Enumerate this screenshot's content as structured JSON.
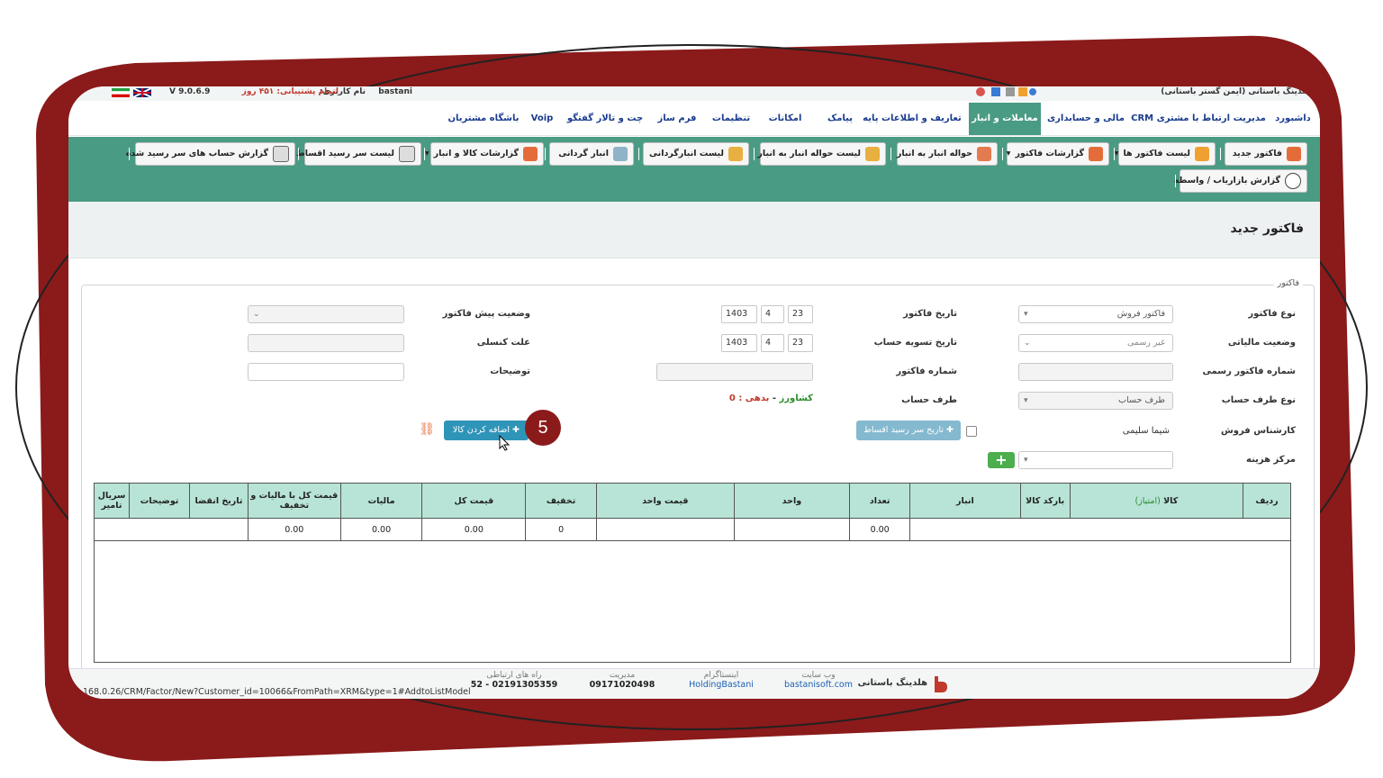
{
  "colors": {
    "frame": "#8b1a1a",
    "toolbar": "#4a9b84",
    "header_row": "#b7e4d6",
    "link_blue": "#1a3c8f"
  },
  "topbar": {
    "username_label": "نام کاربری:",
    "username": "bastani",
    "support_label": "اتمام پشتیبانی: ۴۵۱ روز",
    "version": "V 9.0.6.9",
    "company": "هلدینگ باستانی (ایمن گستر باستانی)",
    "flags": [
      "iran-flag-icon",
      "uk-flag-icon"
    ]
  },
  "menu": [
    {
      "label": "داشبورد"
    },
    {
      "label": "مدیریت ارتباط با مشتری CRM"
    },
    {
      "label": "مالی و حسابداری"
    },
    {
      "label": "معاملات و انبار",
      "active": true
    },
    {
      "label": "تعاریف و اطلاعات پایه"
    },
    {
      "label": "پیامک"
    },
    {
      "label": "امکانات"
    },
    {
      "label": "تنظیمات"
    },
    {
      "label": "فرم ساز"
    },
    {
      "label": "چت و تالار گفتگو"
    },
    {
      "label": "Voip"
    },
    {
      "label": "باشگاه مشتریان"
    }
  ],
  "toolbar": {
    "buttons": [
      {
        "label": "فاکتور جدید",
        "icon": "new-invoice-icon"
      },
      {
        "label": "لیست فاکتور ها",
        "icon": "invoice-list-icon",
        "dropdown": true
      },
      {
        "label": "گزارشات فاکتور",
        "icon": "invoice-report-icon",
        "dropdown": true
      },
      {
        "label": "حواله انبار به انبار",
        "icon": "warehouse-transfer-icon"
      },
      {
        "label": "لیست حواله انبار به انبار",
        "icon": "transfer-list-icon"
      },
      {
        "label": "لیست انبارگردانی",
        "icon": "stocktaking-list-icon"
      },
      {
        "label": "انبار گردانی",
        "icon": "stocktaking-icon"
      },
      {
        "label": "گزارشات کالا و انبار",
        "icon": "goods-report-icon",
        "dropdown": true
      },
      {
        "label": "لیست سر رسید اقساط",
        "icon": "installments-icon"
      },
      {
        "label": "گزارش حساب های سر رسید شده",
        "icon": "due-accounts-icon"
      },
      {
        "label": "گزارش بازاریاب / واسطه",
        "icon": "marketer-report-icon"
      }
    ]
  },
  "page_title": "فاکتور جدید",
  "form": {
    "legend": "فاکتور",
    "invoice_type_label": "نوع فاکتور",
    "invoice_type_value": "فاکتور فروش",
    "tax_status_label": "وضعیت مالیاتی",
    "tax_status_value": "غیر رسمی",
    "official_number_label": "شماره فاکتور رسمی",
    "account_side_type_label": "نوع طرف حساب",
    "account_side_type_value": "طرف حساب",
    "sales_expert_label": "کارشناس فروش",
    "sales_expert_value": "شیما سلیمی",
    "cost_center_label": "مرکز هزینه",
    "invoice_date_label": "تاریخ فاکتور",
    "settle_date_label": "تاریخ تسویه حساب",
    "invoice_number_label": "شماره فاکتور",
    "account_side_label": "طرف حساب",
    "date_day": "23",
    "date_month": "4",
    "date_year": "1403",
    "farmer_label": "کشاورز",
    "debt_label": "بدهی : 0",
    "installment_button": "تاریخ سر رسید اقساط",
    "pre_status_label": "وضعیت پیش فاکتور",
    "cancel_reason_label": "علت کنسلی",
    "description_label": "توضیحات",
    "add_goods_button": "اضافه کردن کالا",
    "step_badge": "5"
  },
  "table": {
    "headers": [
      "ردیف",
      "کالا",
      "بارکد کالا",
      "انبار",
      "تعداد",
      "واحد",
      "قیمت واحد",
      "تخفیف",
      "قیمت کل",
      "مالیات",
      "قیمت کل با مالیات و تخفیف",
      "تاریخ انقضا",
      "توضیحات",
      "سریال تامیر"
    ],
    "goods_points_label": "(امتیاز)",
    "totals": {
      "count": "0.00",
      "discount": "0",
      "total": "0.00",
      "tax": "0.00",
      "grand": "0.00"
    }
  },
  "footer": {
    "url": "168.0.26/CRM/Factor/New?Customer_id=10066&FromPath=XRM&type=1#AddtoListModel",
    "contact_label": "راه های ارتباطی",
    "contact_value": "52 - 02191305359",
    "manager_label": "مدیریت",
    "manager_value": "09171020498",
    "instagram_label": "اینستاگرام",
    "instagram_value": "HoldingBastani",
    "website_label": "وب سایت",
    "website_value": "bastanisoft.com",
    "brand": "هلدینگ باستانی"
  }
}
